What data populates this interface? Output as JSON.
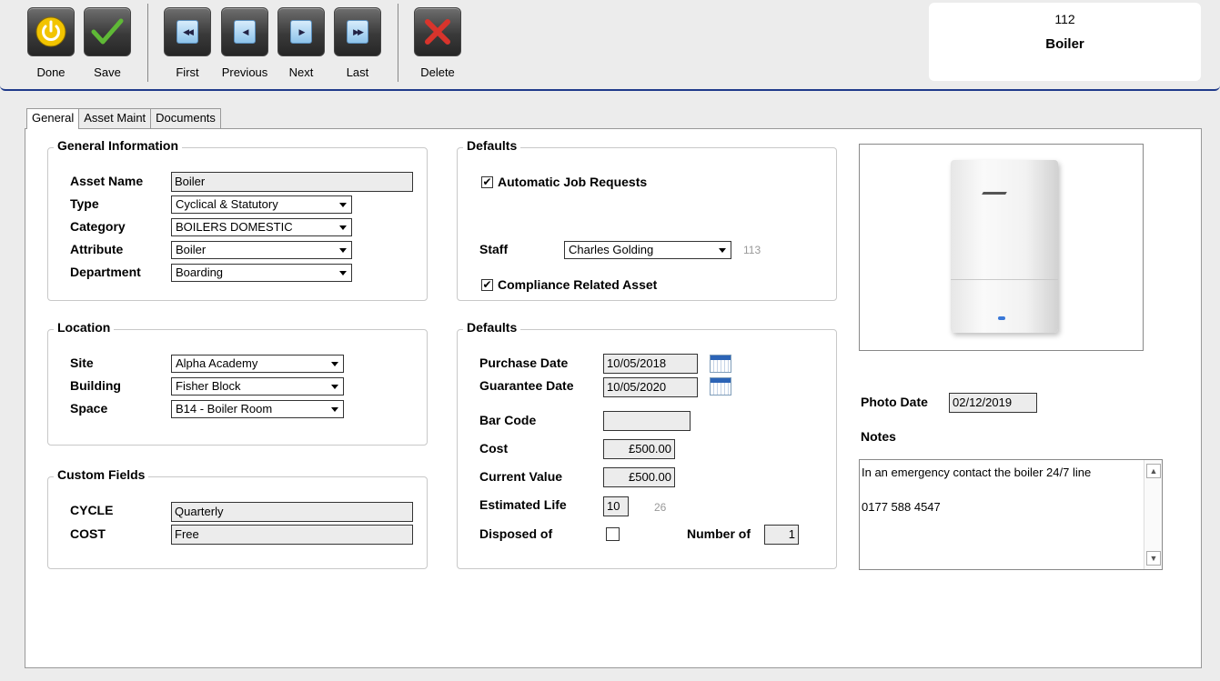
{
  "toolbar": {
    "done": "Done",
    "save": "Save",
    "first": "First",
    "previous": "Previous",
    "next": "Next",
    "last": "Last",
    "delete": "Delete"
  },
  "record": {
    "id": "112",
    "name": "Boiler"
  },
  "tabs": [
    "General",
    "Asset Maint",
    "Documents"
  ],
  "general_info": {
    "title": "General Information",
    "asset_name_label": "Asset Name",
    "asset_name": "Boiler",
    "type_label": "Type",
    "type": "Cyclical & Statutory",
    "category_label": "Category",
    "category": "BOILERS DOMESTIC",
    "attribute_label": "Attribute",
    "attribute": "Boiler",
    "department_label": "Department",
    "department": "Boarding"
  },
  "location": {
    "title": "Location",
    "site_label": "Site",
    "site": "Alpha Academy",
    "building_label": "Building",
    "building": "Fisher Block",
    "space_label": "Space",
    "space": "B14 - Boiler Room"
  },
  "custom_fields": {
    "title": "Custom Fields",
    "cycle_label": "CYCLE",
    "cycle": "Quarterly",
    "cost_label": "COST",
    "cost": "Free"
  },
  "defaults_top": {
    "title": "Defaults",
    "auto_job_label": "Automatic Job Requests",
    "auto_job_checked": true,
    "staff_label": "Staff",
    "staff": "Charles Golding",
    "staff_id": "113",
    "compliance_label": "Compliance Related Asset",
    "compliance_checked": true
  },
  "defaults_bottom": {
    "title": "Defaults",
    "purchase_label": "Purchase Date",
    "purchase_date": "10/05/2018",
    "guarantee_label": "Guarantee Date",
    "guarantee_date": "10/05/2020",
    "barcode_label": "Bar Code",
    "barcode": "",
    "cost_label": "Cost",
    "cost": "£500.00",
    "current_value_label": "Current Value",
    "current_value": "£500.00",
    "estimated_life_label": "Estimated Life",
    "estimated_life": "10",
    "estimated_life_extra": "26",
    "disposed_label": "Disposed of",
    "disposed_checked": false,
    "number_of_label": "Number of",
    "number_of": "1"
  },
  "photo": {
    "photo_date_label": "Photo Date",
    "photo_date": "02/12/2019",
    "notes_label": "Notes",
    "notes_line1": "In an emergency contact the boiler 24/7 line",
    "notes_line2": "0177 588 4547"
  },
  "colors": {
    "accent_border": "#1f3a8a",
    "checkmark_green": "#5fb936",
    "delete_red": "#d8342c",
    "power_yellow": "#f2c400"
  }
}
